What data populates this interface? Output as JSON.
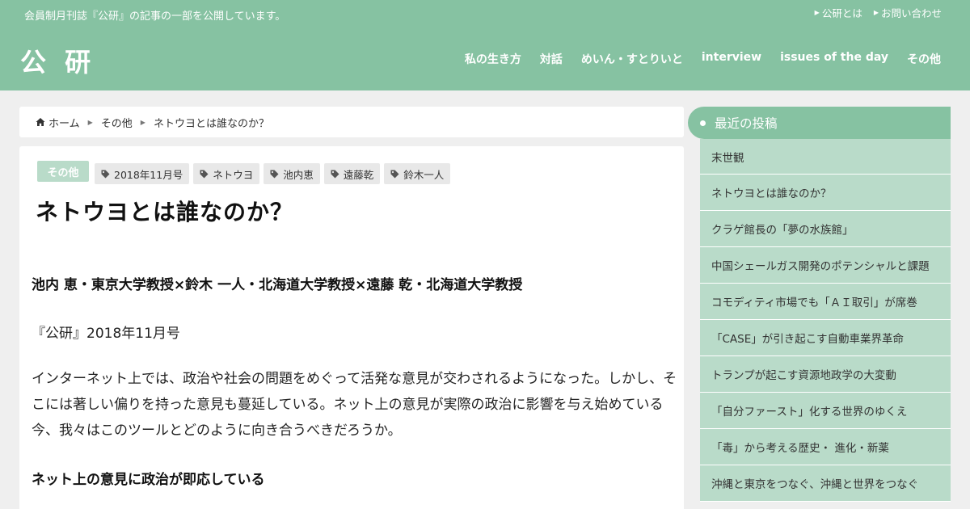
{
  "header": {
    "tagline": "会員制月刊誌『公研』の記事の一部を公開しています。",
    "logo": "公 研",
    "top_links": [
      {
        "label": "公研とは"
      },
      {
        "label": "お問い合わせ"
      }
    ],
    "nav": [
      {
        "label": "私の生き方"
      },
      {
        "label": "対話"
      },
      {
        "label": "めいん・すとりいと"
      },
      {
        "label": "interview"
      },
      {
        "label": "issues of the day"
      },
      {
        "label": "その他"
      }
    ]
  },
  "breadcrumb": {
    "home": "ホーム",
    "category": "その他",
    "current": "ネトウヨとは誰なのか？"
  },
  "article": {
    "category": "その他",
    "tags": [
      "2018年11月号",
      "ネトウヨ",
      "池内恵",
      "遠藤乾",
      "鈴木一人"
    ],
    "title": "ネトウヨとは誰なのか？",
    "authors": "池内 恵・東京大学教授×鈴木 一人・北海道大学教授×遠藤 乾・北海道大学教授",
    "issue": "『公研』2018年11月号",
    "body": "インターネット上では、政治や社会の問題をめぐって活発な意見が交わされるようになった。しかし、そこには著しい偏りを持った意見も蔓延している。ネット上の意見が実際の政治に影響を与え始めている今、我々はこのツールとどのように向き合うべきだろうか。",
    "subheading": "ネット上の意見に政治が即応している"
  },
  "sidebar": {
    "heading": "最近の投稿",
    "posts": [
      "末世観",
      "ネトウヨとは誰なのか？",
      "クラゲ館長の「夢の水族館」",
      "中国シェールガス開発のポテンシャルと課題",
      "コモディティ市場でも「ＡＩ取引」が席巻",
      "「CASE」が引き起こす自動車業界革命",
      "トランプが起こす資源地政学の大変動",
      "「自分ファースト」化する世界のゆくえ",
      "「毒」から考える歴史・ 進化・新薬",
      "沖縄と東京をつなぐ、沖縄と世界をつなぐ"
    ]
  },
  "icons": {
    "home": "home-icon",
    "tag": "tag-icon",
    "caret": "caret-right-icon"
  },
  "colors": {
    "header_bg": "#86c2a2",
    "sidebar_item_bg": "#b9dbc9",
    "page_bg": "#efefef"
  }
}
